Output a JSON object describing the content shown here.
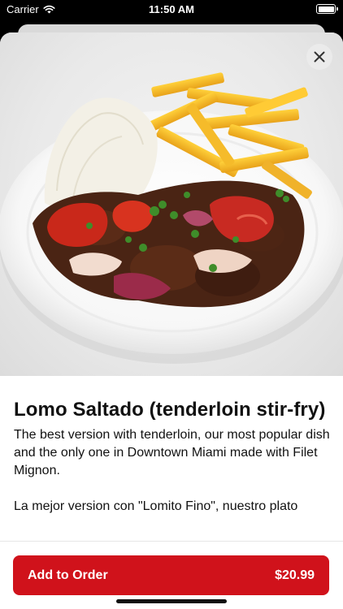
{
  "status_bar": {
    "carrier": "Carrier",
    "time": "11:50 AM",
    "battery_level": 1.0
  },
  "item": {
    "title": "Lomo Saltado (tenderloin stir-fry)",
    "description": "The best version with tenderloin, our most popular dish and the only one in Downtown Miami made with Filet Mignon.\n\nLa mejor version con \"Lomito Fino\", nuestro plato",
    "image_subject": "lomo-saltado-plate"
  },
  "order": {
    "button_label": "Add to Order",
    "price": "$20.99"
  },
  "colors": {
    "accent": "#d0121b",
    "background": "#ffffff",
    "text": "#111111"
  },
  "icons": {
    "close": "close-icon",
    "wifi": "wifi-icon",
    "battery": "battery-icon"
  }
}
